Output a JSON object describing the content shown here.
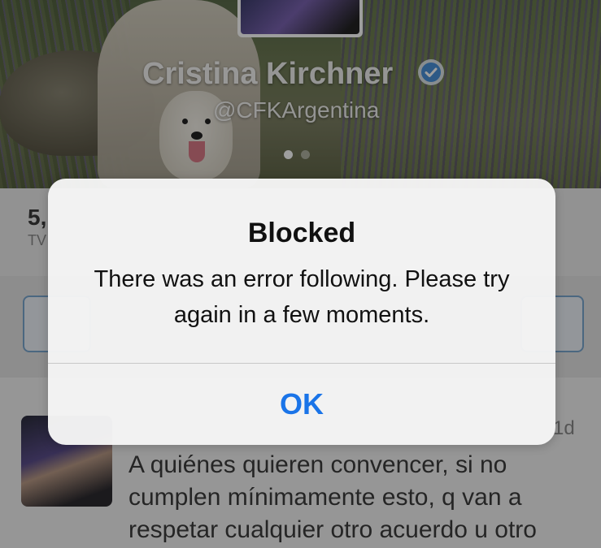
{
  "profile": {
    "name": "Cristina Kirchner",
    "handle": "@CFKArgentina",
    "verified_icon": "verified-badge-icon"
  },
  "stats": {
    "count_partial": "5,",
    "label_partial": "TV"
  },
  "tweet": {
    "time": "1d",
    "lines": [
      "A quiénes quieren convencer, si no",
      "cumplen mínimamente esto, q van a",
      "respetar cualquier otro acuerdo u otro"
    ]
  },
  "alert": {
    "title": "Blocked",
    "message": "There was an error following. Please try again in a few moments.",
    "ok_label": "OK"
  },
  "colors": {
    "accent": "#1a74e8",
    "verified": "#4a90d9"
  }
}
